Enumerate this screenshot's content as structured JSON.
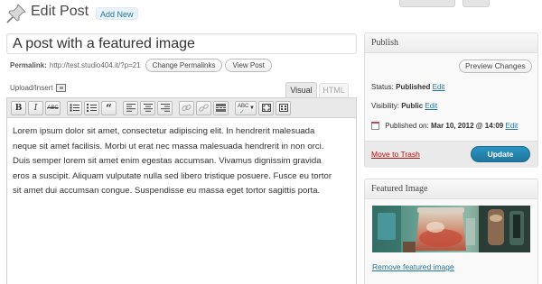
{
  "header": {
    "title": "Edit Post",
    "add_new": "Add New"
  },
  "post": {
    "title": "A post with a featured image"
  },
  "permalink": {
    "label": "Permalink:",
    "url": "http://test.studio404.it/?p=21",
    "change_button": "Change Permalinks",
    "view_button": "View Post"
  },
  "upload": {
    "label": "Upload/Insert"
  },
  "editor": {
    "tabs": {
      "visual": "Visual",
      "html": "HTML"
    },
    "toolbar": {
      "bold": "B",
      "italic": "I",
      "strike": "ABC",
      "blockquote": "“",
      "spellcheck": "ABC"
    },
    "content_lines": [
      "Lorem ipsum dolor sit amet, consectetur adipiscing elit. In hendrerit malesuada",
      "neque sit amet facilisis. Morbi ut erat nec massa malesuada hendrerit in non orci.",
      "Duis semper lorem sit amet enim egestas accumsan. Vivamus dignissim gravida",
      "eros a suscipit. Aliquam vulputate nulla sed libero tristique posuere. Fusce eu tortor",
      "sit amet dui accumsan congue. Suspendisse eu massa eget tortor sagittis porta."
    ]
  },
  "publish": {
    "title": "Publish",
    "preview_button": "Preview Changes",
    "status_label": "Status:",
    "status_value": "Published",
    "visibility_label": "Visibility:",
    "visibility_value": "Public",
    "edit_link": "Edit",
    "published_on_label": "Published on:",
    "published_on_value": "Mar 10, 2012 @ 14:09",
    "trash": "Move to Trash",
    "update_button": "Update"
  },
  "featured_image": {
    "title": "Featured Image",
    "remove_link": "Remove featured image"
  },
  "colors": {
    "link": "#21759b",
    "update_button": "#21759b",
    "trash": "#bc0b0b"
  },
  "icons": [
    "pushpin-icon",
    "upload-media-icon",
    "calendar-icon"
  ]
}
